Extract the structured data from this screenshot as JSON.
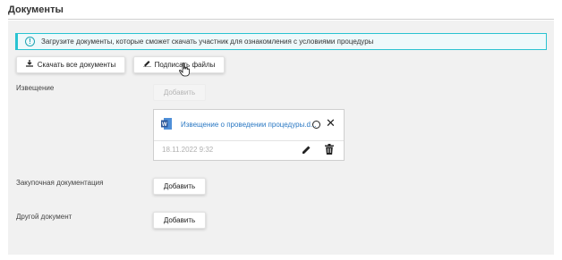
{
  "section": {
    "title": "Документы"
  },
  "info": {
    "text": "Загрузите документы, которые сможет скачать участник для ознакомления с условиями процедуры"
  },
  "toolbar": {
    "download_all_label": "Скачать все документы",
    "sign_files_label": "Подписать файлы"
  },
  "notice": {
    "label": "Извещение",
    "add_label": "Добавить",
    "file": {
      "name": "Извещение о проведении процедуры.d...",
      "date": "18.11.2022 9:32"
    }
  },
  "procurement_docs": {
    "label": "Закупочная документация",
    "add_label": "Добавить"
  },
  "other_doc": {
    "label": "Другой документ",
    "add_label": "Добавить"
  },
  "colors": {
    "accent": "#29c3d1",
    "link": "#2a78c3",
    "word_blue": "#2b579a"
  }
}
